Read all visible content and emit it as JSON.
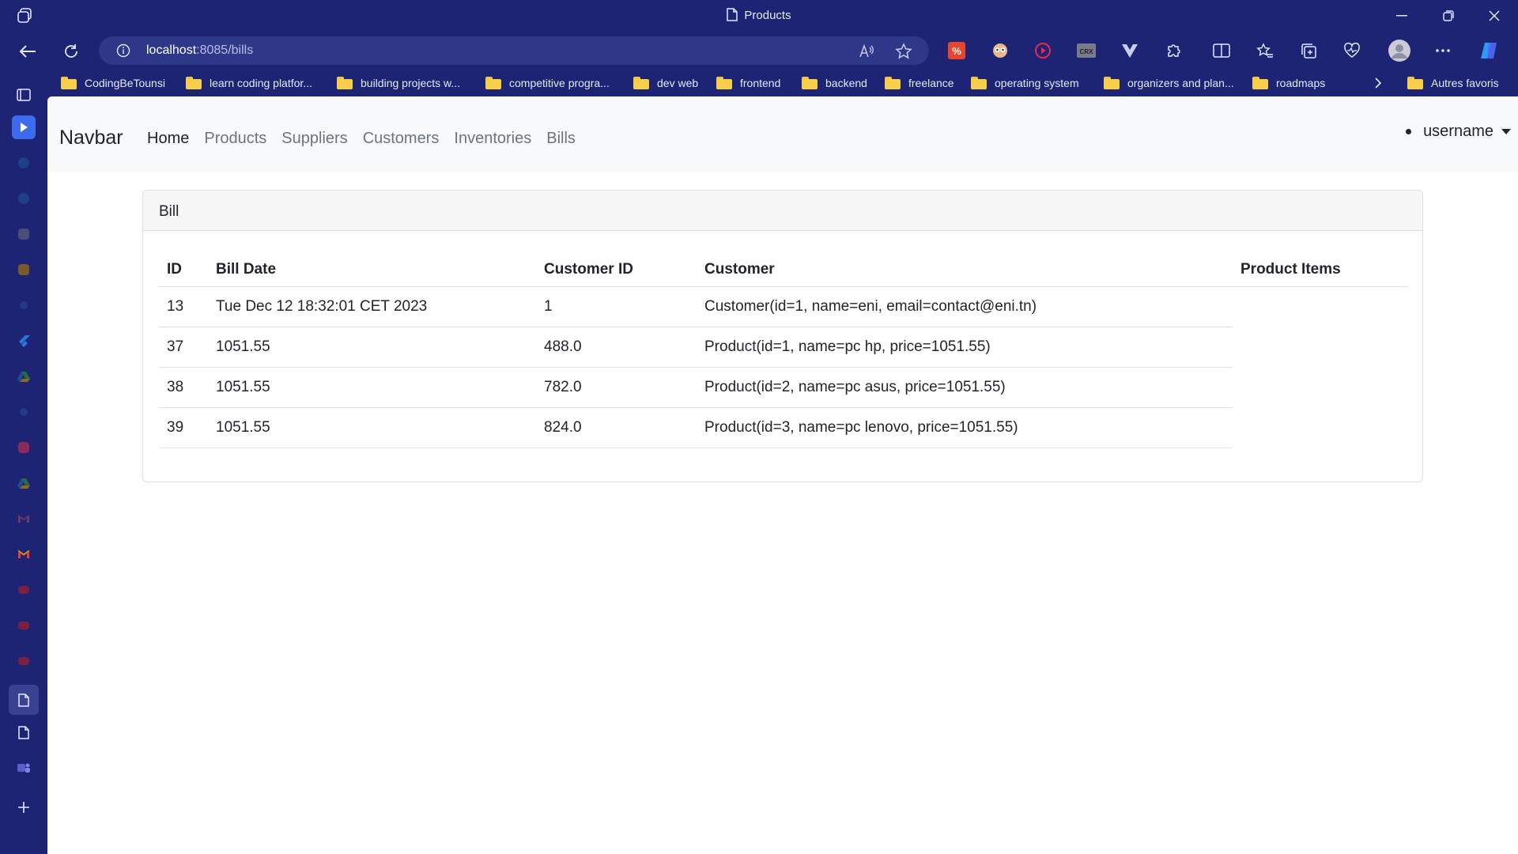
{
  "browser": {
    "tab_title": "Products",
    "url_host": "localhost",
    "url_path": ":8085/bills",
    "bookmarks": [
      "CodingBeTounsi",
      "learn coding platfor...",
      "building projects w...",
      "competitive progra...",
      "dev web",
      "frontend",
      "backend",
      "freelance",
      "operating system",
      "organizers and plan...",
      "roadmaps"
    ],
    "other_favorites": "Autres favoris"
  },
  "navbar": {
    "brand": "Navbar",
    "links": [
      "Home",
      "Products",
      "Suppliers",
      "Customers",
      "Inventories",
      "Bills"
    ],
    "user": "username"
  },
  "card": {
    "header": "Bill",
    "columns": [
      "ID",
      "Bill Date",
      "Customer ID",
      "Customer",
      "Product Items"
    ],
    "rows": [
      {
        "id": "13",
        "bill_date": "Tue Dec 12 18:32:01 CET 2023",
        "customer_id": "1",
        "customer": "Customer(id=1, name=eni, email=contact@eni.tn)"
      },
      {
        "id": "37",
        "bill_date": "1051.55",
        "customer_id": "488.0",
        "customer": "Product(id=1, name=pc hp, price=1051.55)"
      },
      {
        "id": "38",
        "bill_date": "1051.55",
        "customer_id": "782.0",
        "customer": "Product(id=2, name=pc asus, price=1051.55)"
      },
      {
        "id": "39",
        "bill_date": "1051.55",
        "customer_id": "824.0",
        "customer": "Product(id=3, name=pc lenovo, price=1051.55)"
      }
    ]
  },
  "colors": {
    "chrome": "#1d2474",
    "omnibox": "#2f3888",
    "navbar_bg": "#f8f9fa"
  }
}
